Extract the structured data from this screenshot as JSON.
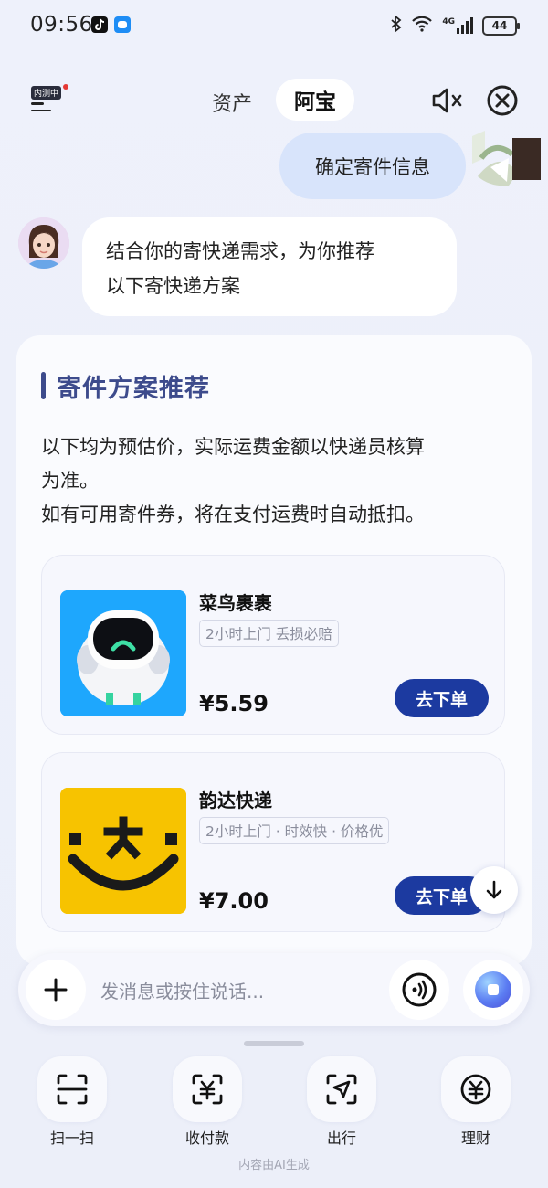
{
  "status_bar": {
    "time": "09:56",
    "battery": "44",
    "network": "4G"
  },
  "header": {
    "beta_badge": "内测中",
    "tabs": [
      "资产",
      "阿宝"
    ],
    "active_tab": "阿宝"
  },
  "chat": {
    "user_message": "确定寄件信息",
    "bot_message_line1": "结合你的寄快递需求，为你推荐",
    "bot_message_line2": "以下寄快递方案"
  },
  "card": {
    "title": "寄件方案推荐",
    "desc_line1": "以下均为预估价，实际运费金额以快递员核算",
    "desc_line2": "为准。",
    "desc_line3": "如有可用寄件券，将在支付运费时自动抵扣。",
    "options": [
      {
        "name": "菜鸟裹裹",
        "tags": "2小时上门  丢损必赔",
        "price": "¥5.59",
        "button": "去下单",
        "brand_color": "#1ea7fd"
      },
      {
        "name": "韵达快递",
        "tags": "2小时上门 · 时效快 · 价格优",
        "price": "¥7.00",
        "button": "去下单",
        "brand_color": "#f7c300"
      }
    ]
  },
  "input": {
    "placeholder": "发消息或按住说话..."
  },
  "quick_actions": [
    {
      "label": "扫一扫",
      "icon": "scan-icon"
    },
    {
      "label": "收付款",
      "icon": "payment-icon"
    },
    {
      "label": "出行",
      "icon": "navigation-icon"
    },
    {
      "label": "理财",
      "icon": "finance-icon"
    }
  ],
  "footnote": "内容由AI生成",
  "colors": {
    "accent": "#1c3aa0",
    "title": "#3d4b8c",
    "user_bubble": "#d8e4fb"
  }
}
